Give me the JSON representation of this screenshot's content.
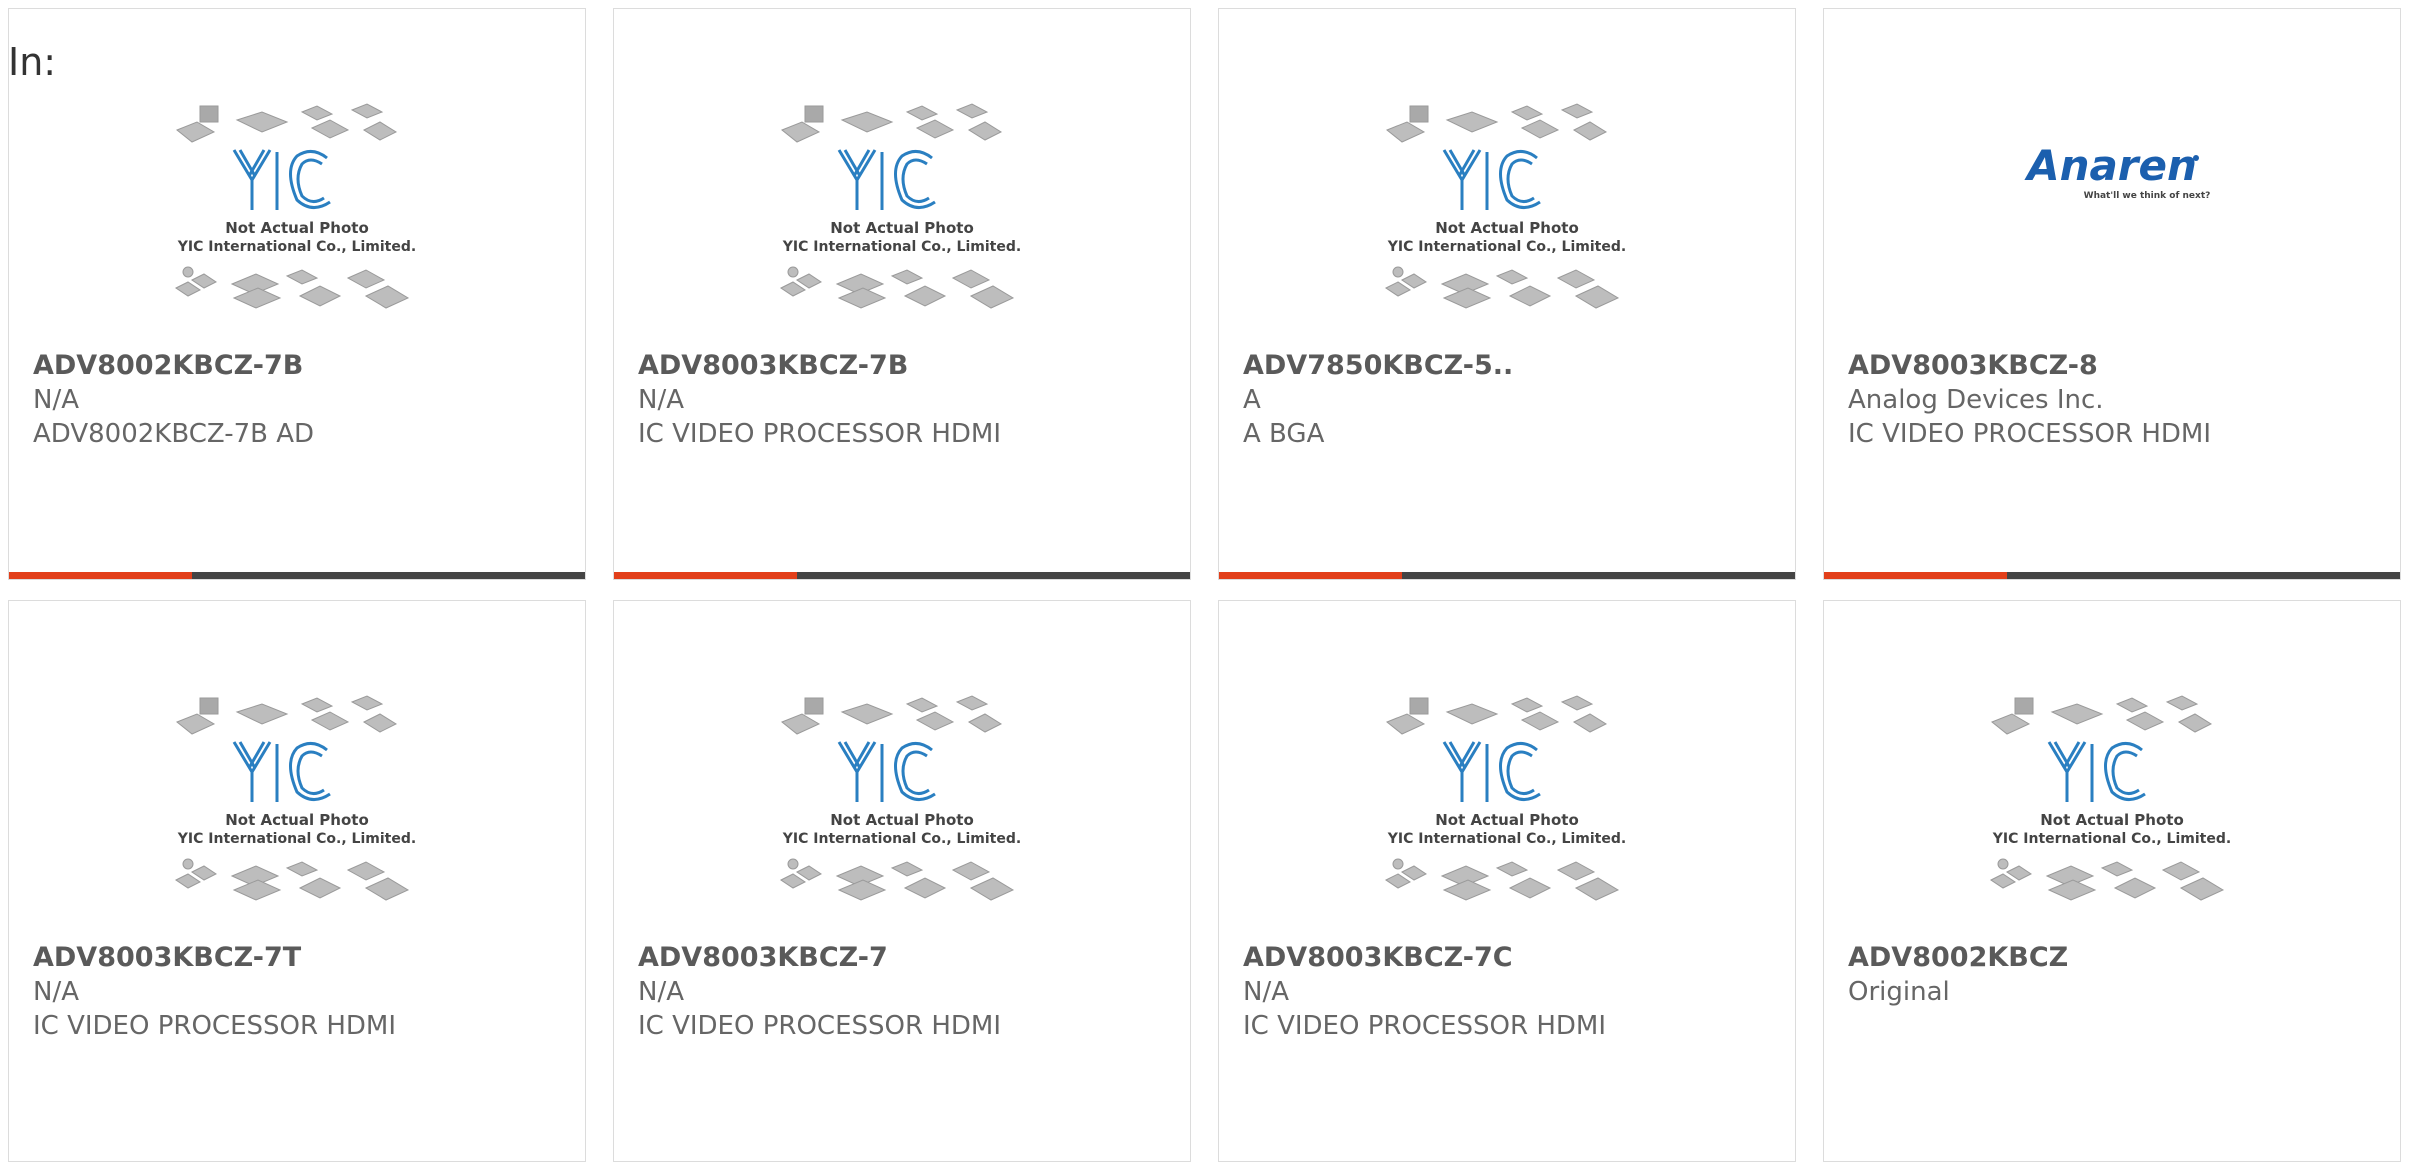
{
  "page": {
    "in_label": "In:"
  },
  "placeholder": {
    "line1": "Not Actual Photo",
    "line2": "YIC International Co., Limited."
  },
  "anaren": {
    "name": "Anaren",
    "tagline": "What'll we think of next?"
  },
  "colors": {
    "accent": "#e23f1a",
    "bar": "#444444",
    "yic_blue": "#2a7fc1",
    "anaren_blue": "#1b5fae"
  },
  "products": [
    {
      "part": "ADV8002KBCZ-7B",
      "mfr": "N/A",
      "desc": "ADV8002KBCZ-7B AD",
      "image": "yic-placeholder-icon"
    },
    {
      "part": "ADV8003KBCZ-7B",
      "mfr": "N/A",
      "desc": "IC VIDEO PROCESSOR HDMI",
      "image": "yic-placeholder-icon"
    },
    {
      "part": "ADV7850KBCZ-5..",
      "mfr": "A",
      "desc": "A BGA",
      "image": "yic-placeholder-icon"
    },
    {
      "part": "ADV8003KBCZ-8",
      "mfr": "Analog Devices Inc.",
      "desc": "IC VIDEO PROCESSOR HDMI",
      "image": "anaren-logo-icon"
    },
    {
      "part": "ADV8003KBCZ-7T",
      "mfr": "N/A",
      "desc": "IC VIDEO PROCESSOR HDMI",
      "image": "yic-placeholder-icon"
    },
    {
      "part": "ADV8003KBCZ-7",
      "mfr": "N/A",
      "desc": "IC VIDEO PROCESSOR HDMI",
      "image": "yic-placeholder-icon"
    },
    {
      "part": "ADV8003KBCZ-7C",
      "mfr": "N/A",
      "desc": "IC VIDEO PROCESSOR HDMI",
      "image": "yic-placeholder-icon"
    },
    {
      "part": "ADV8002KBCZ",
      "mfr": "Original",
      "desc": "",
      "image": "yic-placeholder-icon"
    }
  ]
}
